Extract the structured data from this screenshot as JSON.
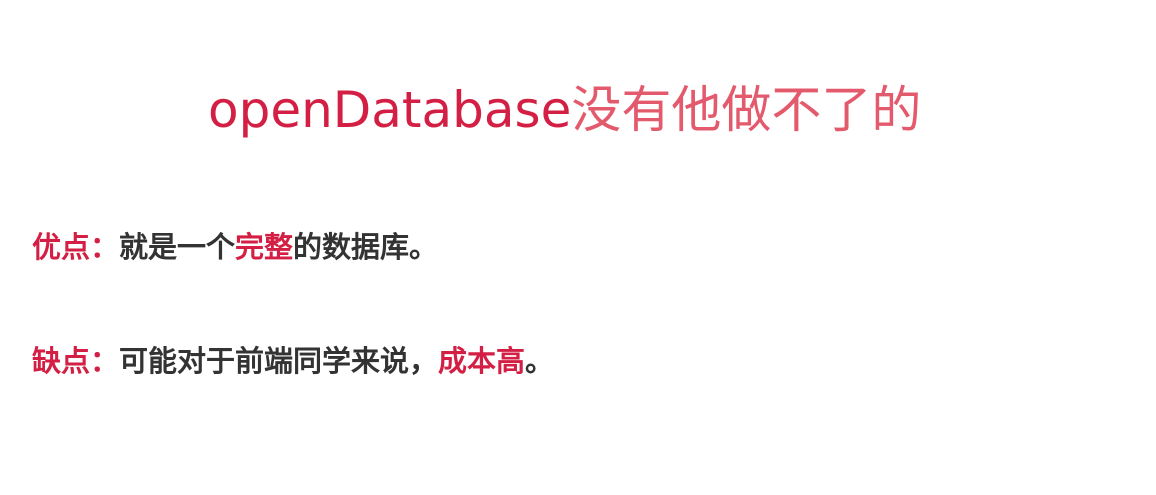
{
  "colors": {
    "accent": "#d41f44",
    "accent_light": "#e45a6d",
    "body_text": "#333333",
    "background": "#ffffff"
  },
  "title": {
    "en": "openDatabase",
    "cn": "没有他做不了的"
  },
  "pros": {
    "label": "优点：",
    "text_before": "就是一个",
    "highlight": "完整",
    "text_after": "的数据库。"
  },
  "cons": {
    "label": "缺点：",
    "text_before": "可能对于前端同学来说，",
    "highlight": "成本高",
    "text_after": "。"
  }
}
